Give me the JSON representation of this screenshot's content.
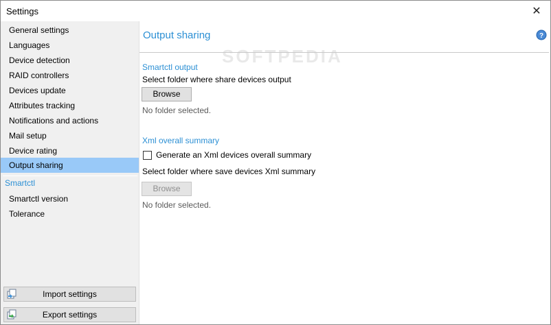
{
  "window": {
    "title": "Settings",
    "close_glyph": "✕"
  },
  "watermark": "SOFTPEDIA",
  "sidebar": {
    "items": [
      {
        "label": "General settings"
      },
      {
        "label": "Languages"
      },
      {
        "label": "Device detection"
      },
      {
        "label": "RAID controllers"
      },
      {
        "label": "Devices update"
      },
      {
        "label": "Attributes tracking"
      },
      {
        "label": "Notifications and actions"
      },
      {
        "label": "Mail setup"
      },
      {
        "label": "Device rating"
      },
      {
        "label": "Output sharing",
        "selected": true
      }
    ],
    "section": "Smartctl",
    "section_items": [
      {
        "label": "Smartctl version"
      },
      {
        "label": "Tolerance"
      }
    ],
    "import_label": "Import settings",
    "export_label": "Export settings",
    "import_icon": "import-icon",
    "export_icon": "export-icon"
  },
  "main": {
    "title": "Output sharing",
    "help_icon": "help-icon",
    "smartctl": {
      "section": "Smartctl output",
      "description": "Select folder where share devices output",
      "browse_label": "Browse",
      "status": "No folder selected."
    },
    "xml": {
      "section": "Xml overall summary",
      "checkbox_label": "Generate an Xml devices overall summary",
      "checkbox_checked": false,
      "description": "Select folder where save devices Xml summary",
      "browse_label": "Browse",
      "browse_disabled": true,
      "status": "No folder selected."
    }
  },
  "colors": {
    "accent": "#2b8fd4",
    "selection": "#99c9f8",
    "sidebar_bg": "#f0f0f0",
    "button_bg": "#e1e1e1"
  }
}
